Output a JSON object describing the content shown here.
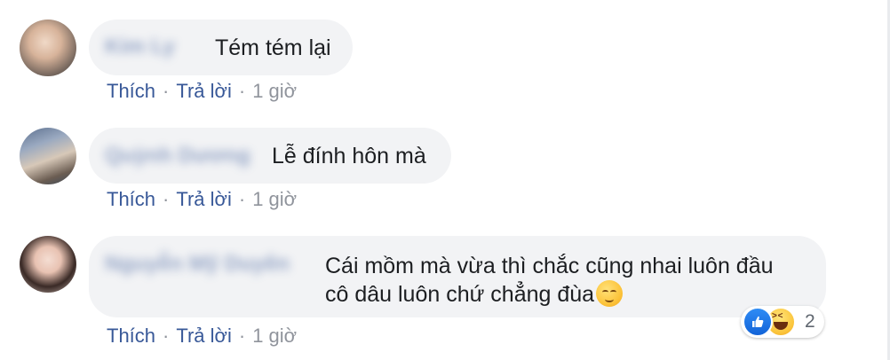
{
  "comments": [
    {
      "author": "Kim Ly",
      "text": "Tém tém lại",
      "actions": {
        "like": "Thích",
        "reply": "Trả lời",
        "time": "1 giờ"
      }
    },
    {
      "author": "Quỳnh Dương",
      "text": "Lễ đính hôn mà",
      "actions": {
        "like": "Thích",
        "reply": "Trả lời",
        "time": "1 giờ"
      }
    },
    {
      "author": "Nguyễn Mỹ Duyên",
      "text_line1": "Cái mồm mà vừa thì chắc cũng nhai luôn đầu",
      "text_line2": "cô dâu luôn chứ chẳng đùa",
      "emoji": "relieved-face-emoji",
      "actions": {
        "like": "Thích",
        "reply": "Trả lời",
        "time": "1 giờ"
      },
      "reactions": {
        "icons": [
          "like-icon",
          "haha-icon"
        ],
        "count": "2"
      }
    }
  ],
  "separator": "·",
  "colors": {
    "link": "#385898",
    "bubble": "#f2f3f5",
    "meta": "#90949c",
    "text": "#1c1e21",
    "like_blue": "#1877f2"
  }
}
